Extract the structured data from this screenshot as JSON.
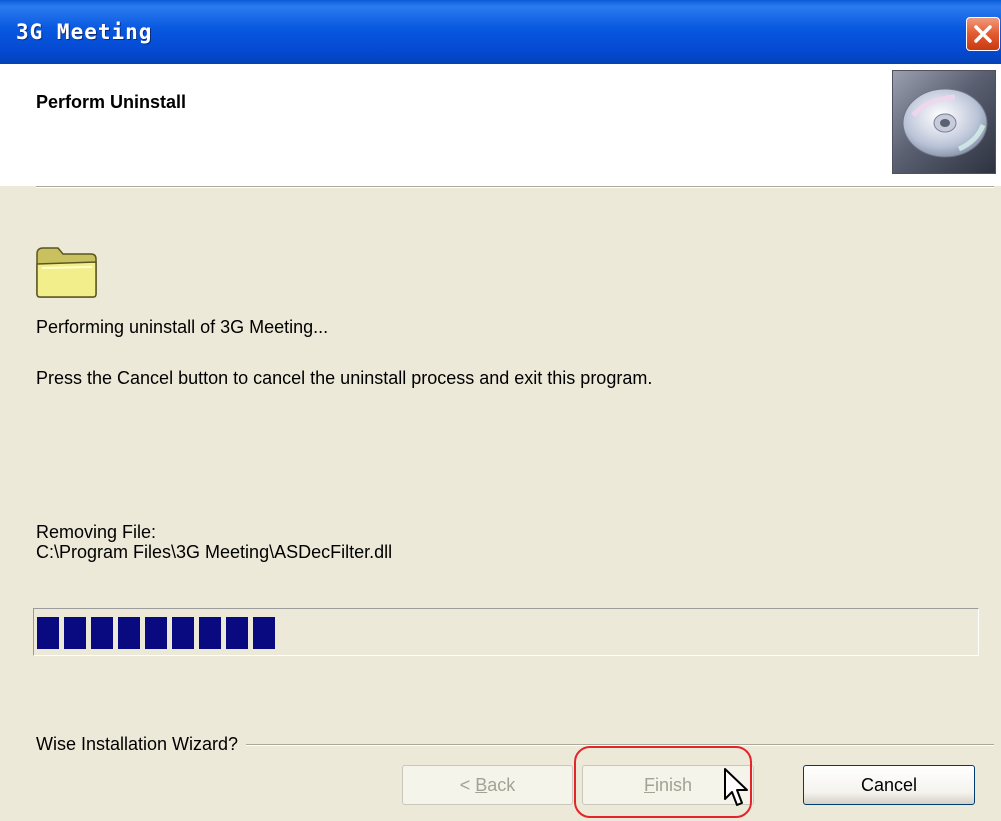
{
  "window": {
    "title": "3G Meeting"
  },
  "header": {
    "title": "Perform Uninstall"
  },
  "body": {
    "performing_text": "Performing uninstall of 3G Meeting...",
    "instruction_text": "Press the Cancel button to cancel the uninstall process and exit this program.",
    "removing_label": "Removing File:",
    "removing_path": "C:\\Program Files\\3G Meeting\\ASDecFilter.dll"
  },
  "progress": {
    "percent": 26,
    "block_count": 9,
    "fill_color": "#0A0A80"
  },
  "footer": {
    "group_label": "Wise Installation Wizard?"
  },
  "buttons": {
    "back": {
      "prefix": "< ",
      "accel": "B",
      "rest": "ack",
      "enabled": false
    },
    "finish": {
      "accel": "F",
      "rest": "inish",
      "enabled": false
    },
    "cancel": {
      "label": "Cancel",
      "enabled": true
    }
  },
  "icons": {
    "close": "close-icon",
    "header": "cd-disc-icon",
    "folder": "folder-icon",
    "cursor": "mouse-cursor-icon"
  },
  "colors": {
    "titlebar": "#0A5BD8",
    "dialog_background": "#ECE9D8",
    "highlight": "#E4232A"
  }
}
